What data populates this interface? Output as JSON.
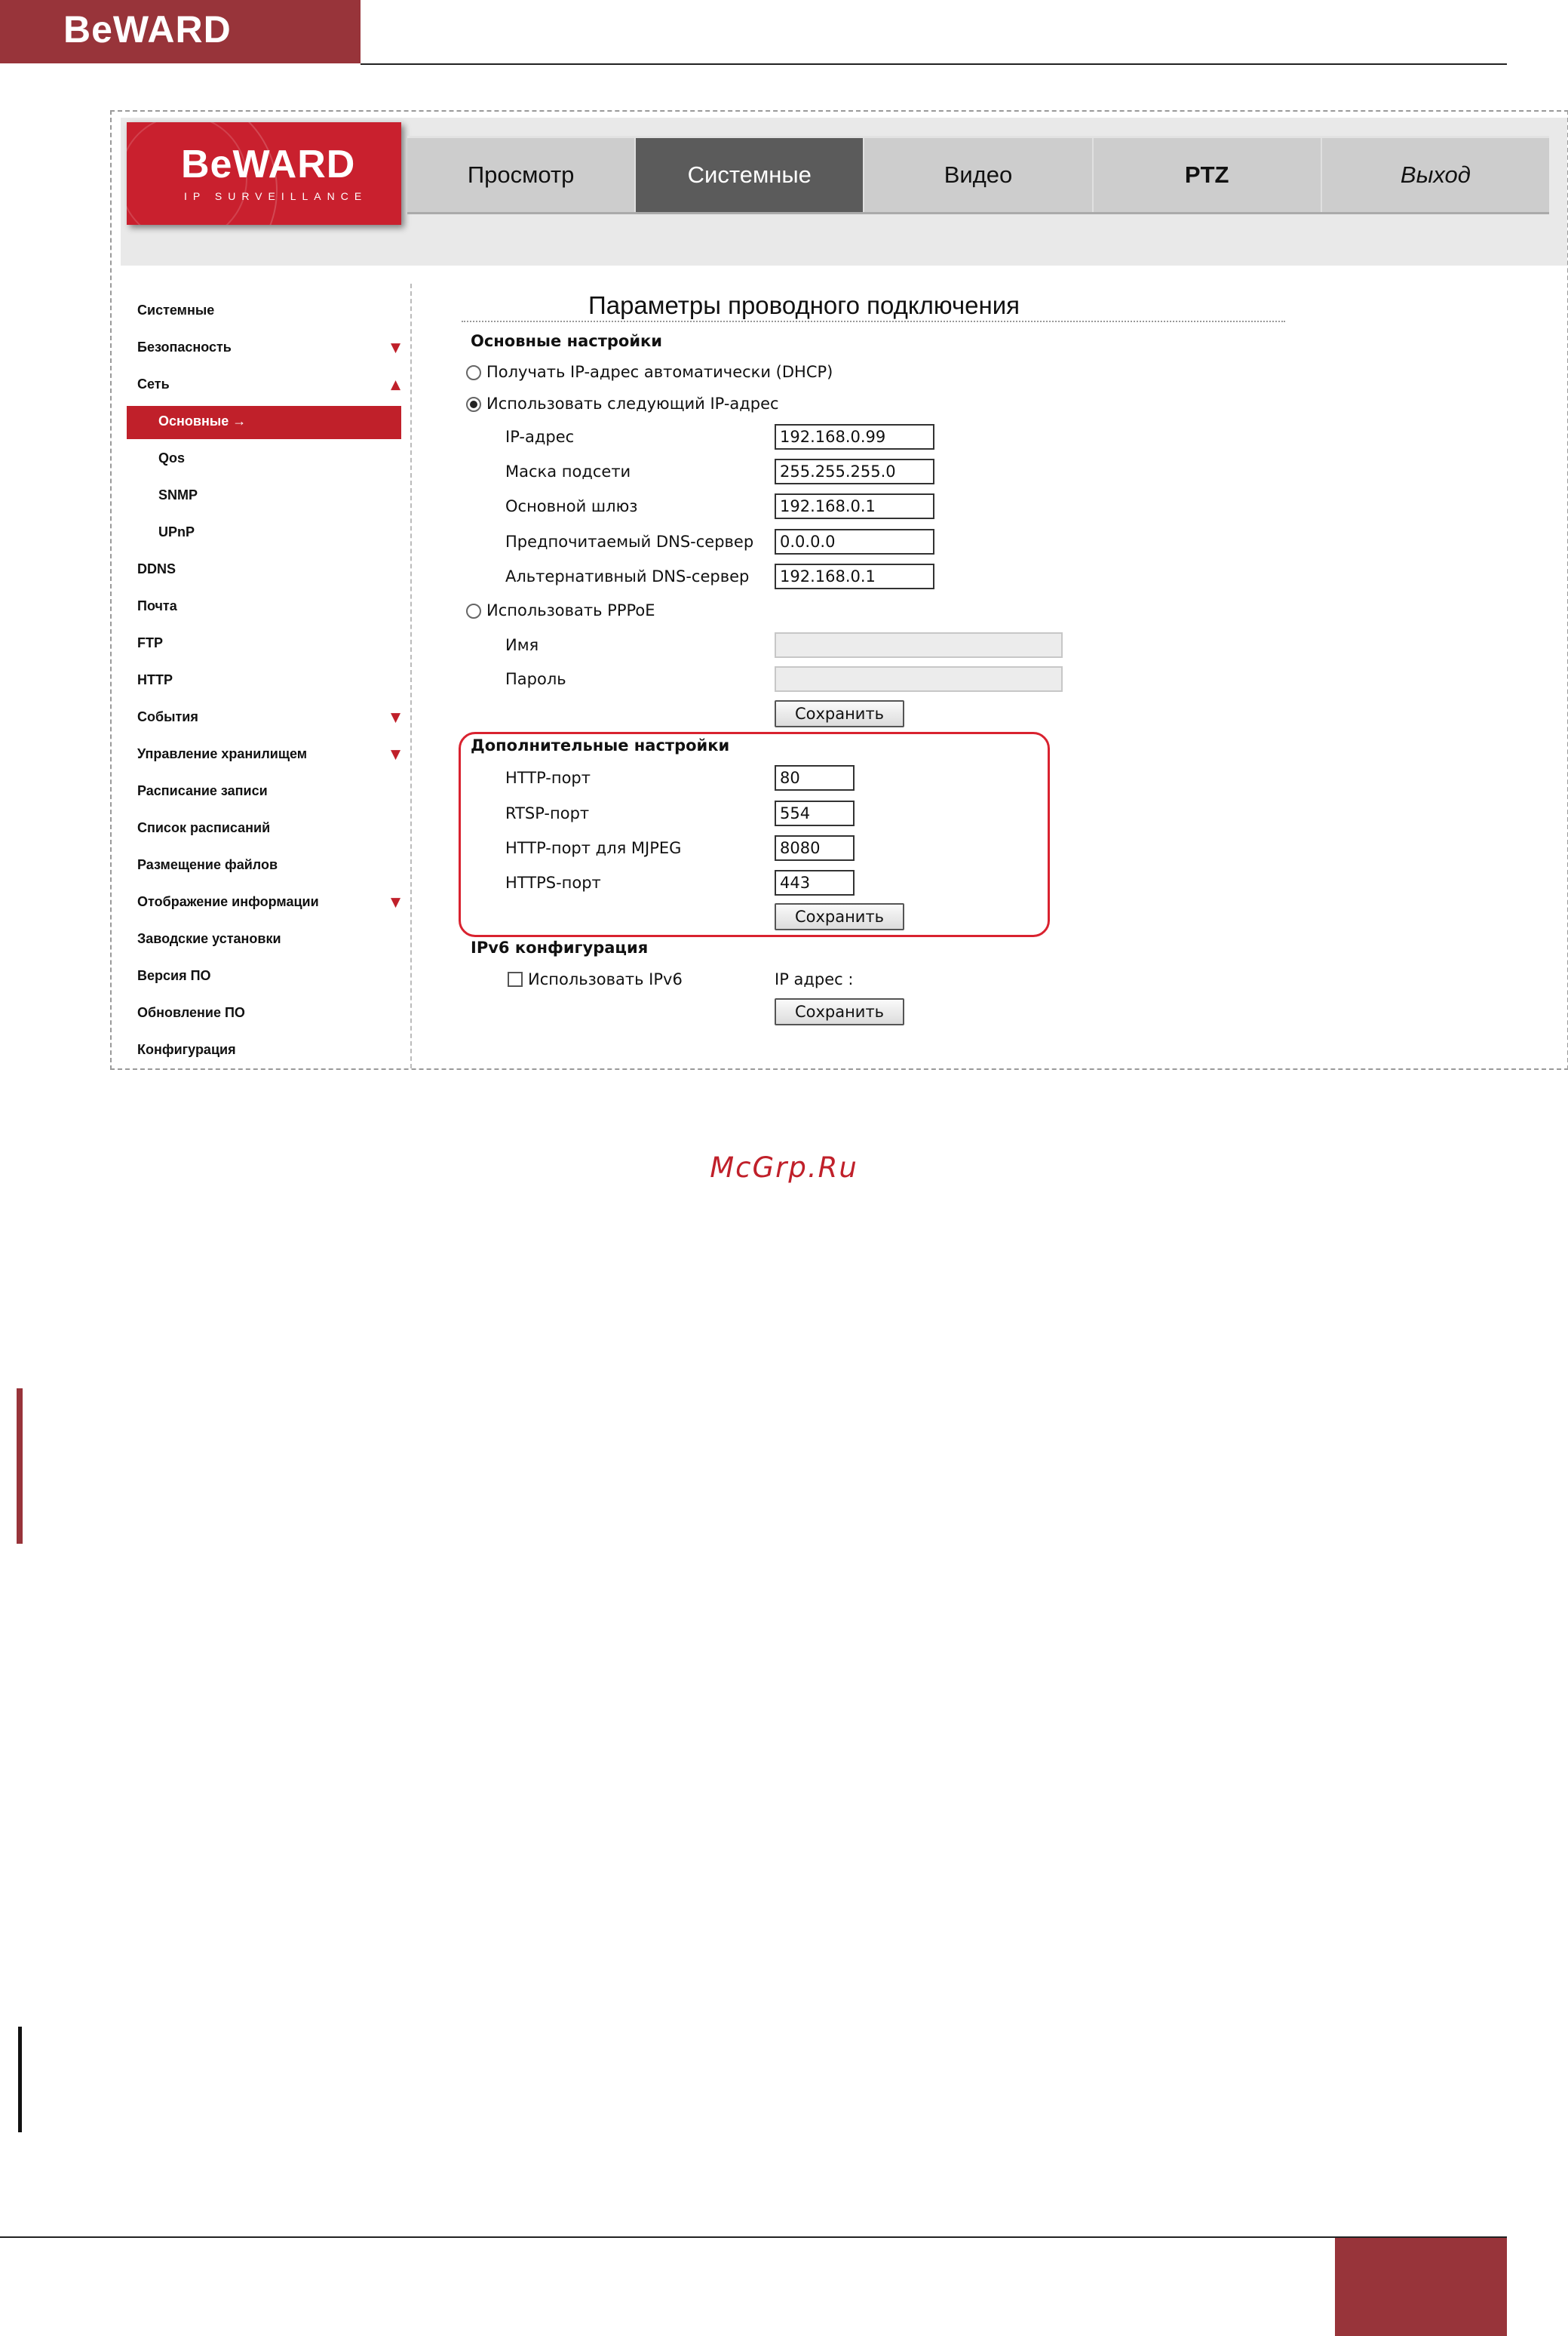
{
  "page": {
    "brand": "BeWARD",
    "watermark": "McGrp.Ru"
  },
  "app": {
    "logo_text": "BeWARD",
    "logo_sub": "IP SURVEILLANCE",
    "tabs": [
      "Просмотр",
      "Системные",
      "Видео",
      "PTZ",
      "Выход"
    ],
    "active_tab": "Системные"
  },
  "sidebar": {
    "items": [
      {
        "label": "Системные"
      },
      {
        "label": "Безопасность",
        "arrow": "▼"
      },
      {
        "label": "Сеть",
        "arrow": "▲"
      },
      {
        "label": "Основные →",
        "sub": true,
        "selected": true
      },
      {
        "label": "Qos",
        "sub": true
      },
      {
        "label": "SNMP",
        "sub": true
      },
      {
        "label": "UPnP",
        "sub": true
      },
      {
        "label": "DDNS"
      },
      {
        "label": "Почта"
      },
      {
        "label": "FTP"
      },
      {
        "label": "HTTP"
      },
      {
        "label": "События",
        "arrow": "▼"
      },
      {
        "label": "Управление хранилищем",
        "arrow": "▼"
      },
      {
        "label": "Расписание записи"
      },
      {
        "label": "Список расписаний"
      },
      {
        "label": "Размещение файлов"
      },
      {
        "label": "Отображение информации",
        "arrow": "▼"
      },
      {
        "label": "Заводские установки"
      },
      {
        "label": "Версия ПО"
      },
      {
        "label": "Обновление ПО"
      },
      {
        "label": "Конфигурация"
      }
    ]
  },
  "main": {
    "title": "Параметры проводного подключения",
    "basic": {
      "heading": "Основные настройки",
      "dhcp_label": "Получать IP-адрес автоматически (DHCP)",
      "static_label": "Использовать следующий IP-адрес",
      "ip_label": "IP-адрес",
      "ip_value": "192.168.0.99",
      "mask_label": "Маска подсети",
      "mask_value": "255.255.255.0",
      "gw_label": "Основной шлюз",
      "gw_value": "192.168.0.1",
      "dns1_label": "Предпочитаемый DNS-сервер",
      "dns1_value": "0.0.0.0",
      "dns2_label": "Альтернативный DNS-сервер",
      "dns2_value": "192.168.0.1",
      "pppoe_label": "Использовать PPPoE",
      "name_label": "Имя",
      "name_value": "",
      "pass_label": "Пароль",
      "pass_value": "",
      "save": "Сохранить"
    },
    "advanced": {
      "heading": "Дополнительные настройки",
      "http_label": "HTTP-порт",
      "http_value": "80",
      "rtsp_label": "RTSP-порт",
      "rtsp_value": "554",
      "mjpeg_label": "HTTP-порт для MJPEG",
      "mjpeg_value": "8080",
      "https_label": "HTTPS-порт",
      "https_value": "443",
      "save": "Сохранить"
    },
    "ipv6": {
      "heading": "IPv6 конфигурация",
      "use_label": "Использовать IPv6",
      "ip_label": "IP адрес :",
      "save": "Сохранить"
    }
  },
  "colors": {
    "brand": "#98343a",
    "logo_red": "#c9202e",
    "accent_red": "#c0202a",
    "active_tab": "#5b5b5b"
  }
}
